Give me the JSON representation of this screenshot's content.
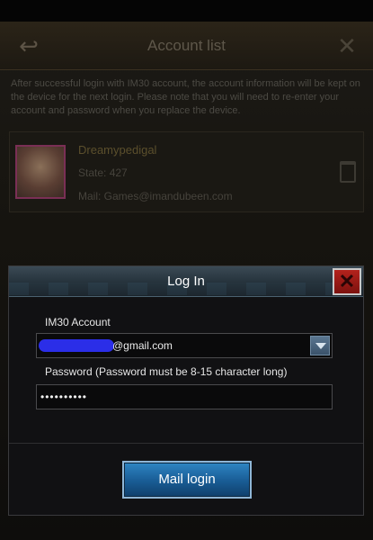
{
  "background": {
    "back_icon": "back-arrow-icon",
    "title": "Account list",
    "close_icon": "close-icon",
    "description": "After successful login with IM30 account, the account information will be kept on the device for the next login. Please note that you will need to re-enter your account and password when you replace the device.",
    "account": {
      "name": "Dreamypedigal",
      "state": "State: 427",
      "mail": "Mail: Games@imandubeen.com",
      "trash_icon": "trash-icon"
    }
  },
  "dialog": {
    "title": "Log In",
    "close_icon": "close-icon",
    "close_glyph": "✕",
    "account_label": "IM30 Account",
    "account_value": "@gmail.com",
    "password_label": "Password (Password must be 8-15 character long)",
    "password_value": "••••••••••",
    "login_button": "Mail login"
  },
  "colors": {
    "accent": "#1a5f98",
    "close_red": "#b3221c",
    "redaction": "#2b2ee8"
  }
}
